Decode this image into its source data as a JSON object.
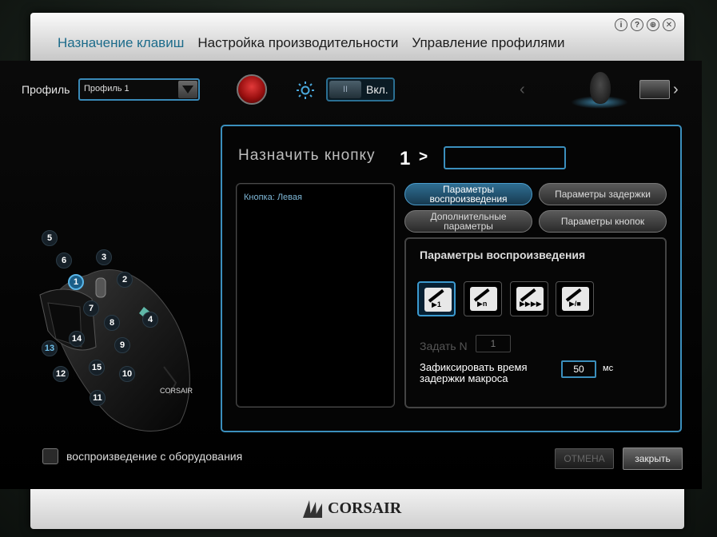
{
  "nav": {
    "tabs": [
      {
        "label": "Назначение клавиш",
        "active": true
      },
      {
        "label": "Настройка производительности",
        "active": false
      },
      {
        "label": "Управление профилями",
        "active": false
      }
    ]
  },
  "window_icons": [
    "info-icon",
    "help-icon",
    "globe-icon",
    "close-icon"
  ],
  "window_icon_glyphs": [
    "i",
    "?",
    "⊕",
    "✕"
  ],
  "profile": {
    "label": "Профиль",
    "selected": "Профиль 1"
  },
  "toggle": {
    "knob_label": "II",
    "state_label": "Вкл."
  },
  "assign": {
    "title": "Назначить кнопку",
    "button_number": "1",
    "arrow": ">",
    "input_value": ""
  },
  "macro_list": {
    "items": [
      "Кнопка: Левая"
    ]
  },
  "param_tabs": {
    "playback": "Параметры воспроизведения",
    "delay": "Параметры задержки",
    "advanced": "Дополнительные параметры",
    "buttons": "Параметры кнопок"
  },
  "playback_panel": {
    "title": "Параметры воспроизведения",
    "modes": [
      {
        "name": "play-once",
        "label": "▶1",
        "active": true
      },
      {
        "name": "play-n-times",
        "label": "▶n",
        "active": false
      },
      {
        "name": "play-repeat",
        "label": "▶▶▶▶",
        "active": false
      },
      {
        "name": "play-toggle",
        "label": "▶/■",
        "active": false
      }
    ],
    "set_n_label": "Задать N",
    "set_n_value": "1",
    "delay_label": "Зафиксировать время задержки макроса",
    "delay_value": "50",
    "delay_unit": "мс"
  },
  "hardware_playback": {
    "label": "воспроизведение с оборудования",
    "checked": false
  },
  "buttons": {
    "cancel": "ОТМЕНА",
    "close": "закрыть"
  },
  "mouse_callouts": [
    "1",
    "2",
    "3",
    "4",
    "5",
    "6",
    "7",
    "8",
    "9",
    "10",
    "11",
    "12",
    "13",
    "14",
    "15"
  ],
  "footer": {
    "logo": "CORSAIR"
  },
  "colors": {
    "accent": "#3b8fbd",
    "active_tab_text": "#1c6b8a",
    "list_text": "#7fb8d8"
  }
}
